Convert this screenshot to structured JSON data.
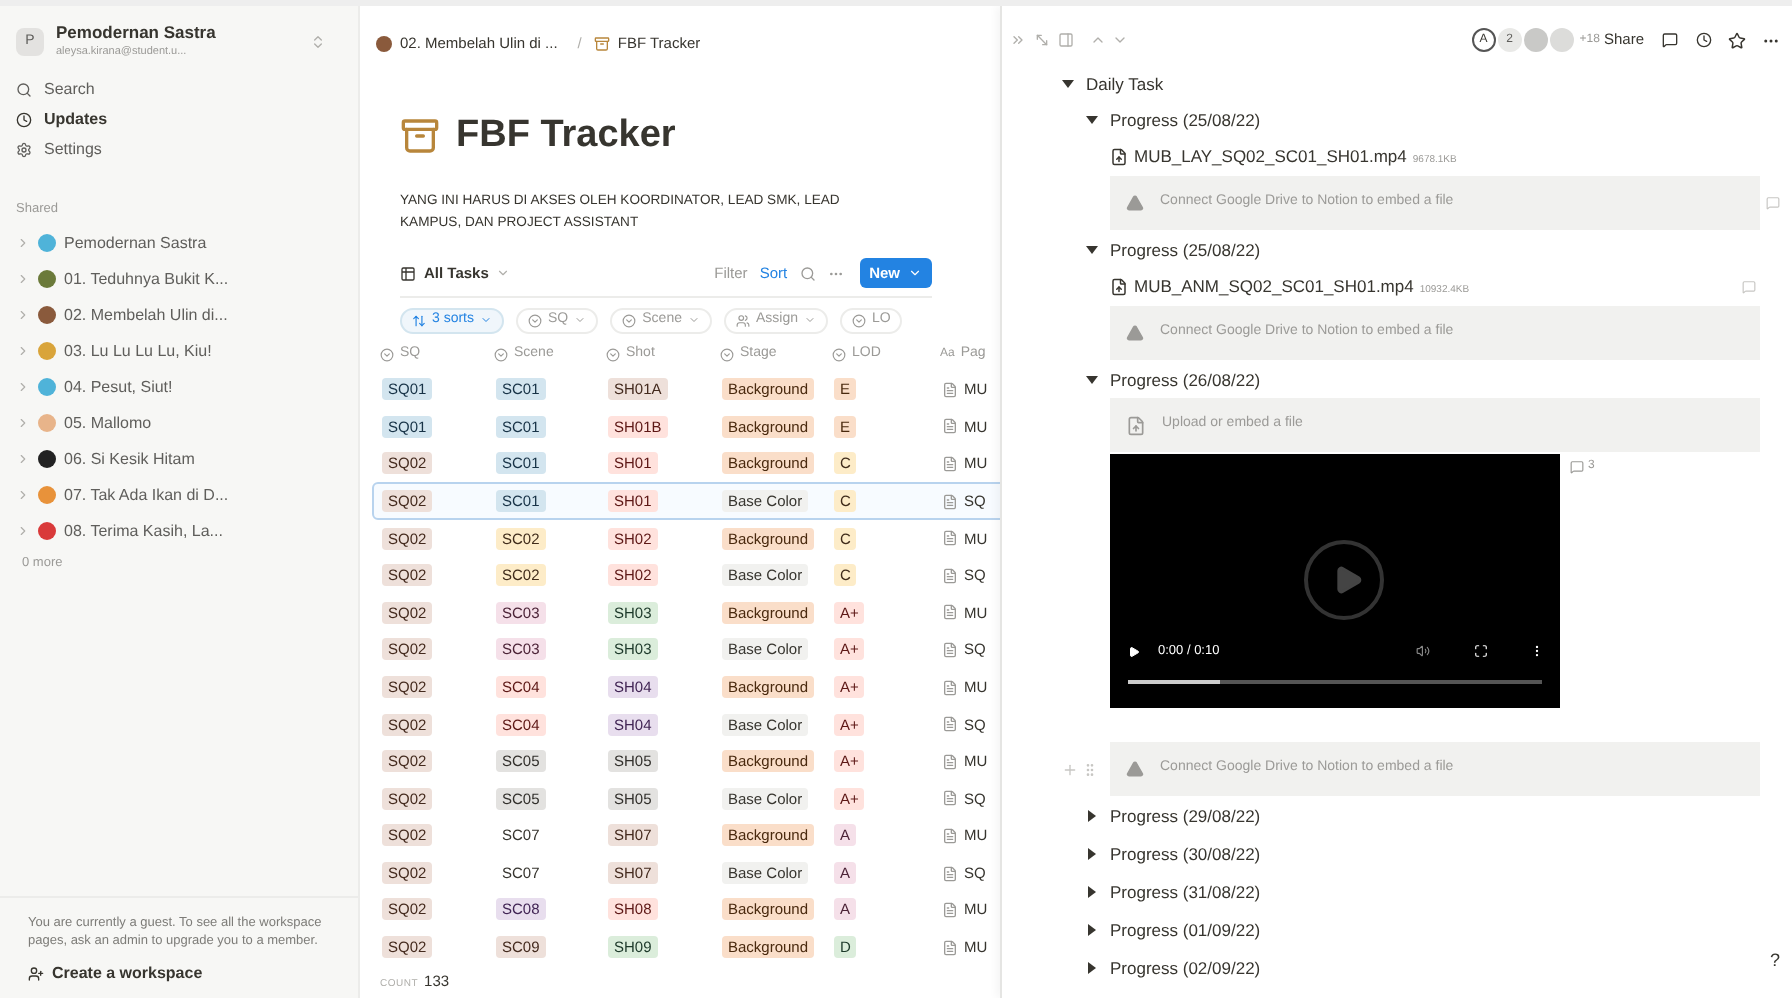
{
  "sidebar": {
    "workspace": {
      "initial": "P",
      "name": "Pemodernan Sastra",
      "email": "aleysa.kirana@student.u..."
    },
    "nav": [
      {
        "kind": "search",
        "label": "Search",
        "selected": false
      },
      {
        "kind": "updates",
        "label": "Updates",
        "selected": true
      },
      {
        "kind": "settings",
        "label": "Settings",
        "selected": false
      }
    ],
    "section": "Shared",
    "pages": [
      {
        "label": "Pemodernan Sastra",
        "color": "#4fb3d9"
      },
      {
        "label": "01. Teduhnya Bukit K...",
        "color": "#6b7a3a"
      },
      {
        "label": "02. Membelah Ulin di...",
        "color": "#8a5a3c"
      },
      {
        "label": "03. Lu Lu Lu Lu, Kiu!",
        "color": "#d9a43a"
      },
      {
        "label": "04. Pesut, Siut!",
        "color": "#4fb3d9"
      },
      {
        "label": "05. Mallomo",
        "color": "#e8b48a"
      },
      {
        "label": "06. Si Kesik Hitam",
        "color": "#222222"
      },
      {
        "label": "07. Tak Ada Ikan di D...",
        "color": "#e8923a"
      },
      {
        "label": "08. Terima Kasih, La...",
        "color": "#d93a3a"
      }
    ],
    "more": "0 more",
    "guest_note": "You are currently a guest. To see all the workspace pages, ask an admin to upgrade you to a member.",
    "create": "Create a workspace"
  },
  "breadcrumbs": [
    "02. Membelah Ulin di ...",
    "FBF Tracker"
  ],
  "breadcrumb_separator": "/",
  "page": {
    "title": "FBF Tracker",
    "description": "YANG INI HARUS DI AKSES OLEH KOORDINATOR, LEAD SMK, LEAD KAMPUS, DAN PROJECT ASSISTANT",
    "view": "All Tasks",
    "filter": "Filter",
    "sort": "Sort",
    "new": "New",
    "chips": [
      {
        "kind": "sort",
        "label": "3 sorts"
      },
      {
        "kind": "select",
        "label": "SQ"
      },
      {
        "kind": "select",
        "label": "Scene"
      },
      {
        "kind": "person",
        "label": "Assign"
      },
      {
        "kind": "select",
        "label": "LO"
      }
    ],
    "columns": [
      {
        "kind": "select",
        "label": "SQ"
      },
      {
        "kind": "select",
        "label": "Scene"
      },
      {
        "kind": "select",
        "label": "Shot"
      },
      {
        "kind": "select",
        "label": "Stage"
      },
      {
        "kind": "select",
        "label": "LOD"
      },
      {
        "kind": "title",
        "icon_text": "Aa",
        "label": "Pag"
      }
    ],
    "rows": [
      {
        "selected": false,
        "tags": [
          {
            "text": "SQ01",
            "color": "#d3e5ef"
          },
          {
            "text": "SC01",
            "color": "#d3e5ef"
          },
          {
            "text": "SH01A",
            "color": "#eee0da"
          },
          {
            "text": "Background",
            "color": "#fadec9"
          },
          {
            "text": "E",
            "color": "#fadec9"
          }
        ],
        "page": "MU"
      },
      {
        "selected": false,
        "tags": [
          {
            "text": "SQ01",
            "color": "#d3e5ef"
          },
          {
            "text": "SC01",
            "color": "#d3e5ef"
          },
          {
            "text": "SH01B",
            "color": "#ffe2dd"
          },
          {
            "text": "Background",
            "color": "#fadec9"
          },
          {
            "text": "E",
            "color": "#fadec9"
          }
        ],
        "page": "MU"
      },
      {
        "selected": false,
        "tags": [
          {
            "text": "SQ02",
            "color": "#eee0da"
          },
          {
            "text": "SC01",
            "color": "#d3e5ef"
          },
          {
            "text": "SH01",
            "color": "#ffe2dd"
          },
          {
            "text": "Background",
            "color": "#fadec9"
          },
          {
            "text": "C",
            "color": "#fdecc8"
          }
        ],
        "page": "MU"
      },
      {
        "selected": true,
        "tags": [
          {
            "text": "SQ02",
            "color": "#eee0da"
          },
          {
            "text": "SC01",
            "color": "#d3e5ef"
          },
          {
            "text": "SH01",
            "color": "#ffe2dd"
          },
          {
            "text": "Base Color",
            "color": "#f1f1ef"
          },
          {
            "text": "C",
            "color": "#fdecc8"
          }
        ],
        "page": "SQ"
      },
      {
        "selected": false,
        "tags": [
          {
            "text": "SQ02",
            "color": "#eee0da"
          },
          {
            "text": "SC02",
            "color": "#fdecc8"
          },
          {
            "text": "SH02",
            "color": "#ffe2dd"
          },
          {
            "text": "Background",
            "color": "#fadec9"
          },
          {
            "text": "C",
            "color": "#fdecc8"
          }
        ],
        "page": "MU"
      },
      {
        "selected": false,
        "tags": [
          {
            "text": "SQ02",
            "color": "#eee0da"
          },
          {
            "text": "SC02",
            "color": "#fdecc8"
          },
          {
            "text": "SH02",
            "color": "#ffe2dd"
          },
          {
            "text": "Base Color",
            "color": "#f1f1ef"
          },
          {
            "text": "C",
            "color": "#fdecc8"
          }
        ],
        "page": "SQ"
      },
      {
        "selected": false,
        "tags": [
          {
            "text": "SQ02",
            "color": "#eee0da"
          },
          {
            "text": "SC03",
            "color": "#f5e0e9"
          },
          {
            "text": "SH03",
            "color": "#dbeddb"
          },
          {
            "text": "Background",
            "color": "#fadec9"
          },
          {
            "text": "A+",
            "color": "#ffe2dd"
          }
        ],
        "page": "MU"
      },
      {
        "selected": false,
        "tags": [
          {
            "text": "SQ02",
            "color": "#eee0da"
          },
          {
            "text": "SC03",
            "color": "#f5e0e9"
          },
          {
            "text": "SH03",
            "color": "#dbeddb"
          },
          {
            "text": "Base Color",
            "color": "#f1f1ef"
          },
          {
            "text": "A+",
            "color": "#ffe2dd"
          }
        ],
        "page": "SQ"
      },
      {
        "selected": false,
        "tags": [
          {
            "text": "SQ02",
            "color": "#eee0da"
          },
          {
            "text": "SC04",
            "color": "#ffe2dd"
          },
          {
            "text": "SH04",
            "color": "#e8deee"
          },
          {
            "text": "Background",
            "color": "#fadec9"
          },
          {
            "text": "A+",
            "color": "#ffe2dd"
          }
        ],
        "page": "MU"
      },
      {
        "selected": false,
        "tags": [
          {
            "text": "SQ02",
            "color": "#eee0da"
          },
          {
            "text": "SC04",
            "color": "#ffe2dd"
          },
          {
            "text": "SH04",
            "color": "#e8deee"
          },
          {
            "text": "Base Color",
            "color": "#f1f1ef"
          },
          {
            "text": "A+",
            "color": "#ffe2dd"
          }
        ],
        "page": "SQ"
      },
      {
        "selected": false,
        "tags": [
          {
            "text": "SQ02",
            "color": "#eee0da"
          },
          {
            "text": "SC05",
            "color": "#e3e2e0"
          },
          {
            "text": "SH05",
            "color": "#e3e2e0"
          },
          {
            "text": "Background",
            "color": "#fadec9"
          },
          {
            "text": "A+",
            "color": "#ffe2dd"
          }
        ],
        "page": "MU"
      },
      {
        "selected": false,
        "tags": [
          {
            "text": "SQ02",
            "color": "#eee0da"
          },
          {
            "text": "SC05",
            "color": "#e3e2e0"
          },
          {
            "text": "SH05",
            "color": "#e3e2e0"
          },
          {
            "text": "Base Color",
            "color": "#f1f1ef"
          },
          {
            "text": "A+",
            "color": "#ffe2dd"
          }
        ],
        "page": "SQ"
      },
      {
        "selected": false,
        "tags": [
          {
            "text": "SQ02",
            "color": "#eee0da"
          },
          {
            "text": "SC07",
            "color": "#ffffff"
          },
          {
            "text": "SH07",
            "color": "#eee0da"
          },
          {
            "text": "Background",
            "color": "#fadec9"
          },
          {
            "text": "A",
            "color": "#f5e0e9"
          }
        ],
        "page": "MU"
      },
      {
        "selected": false,
        "tags": [
          {
            "text": "SQ02",
            "color": "#eee0da"
          },
          {
            "text": "SC07",
            "color": "#ffffff"
          },
          {
            "text": "SH07",
            "color": "#eee0da"
          },
          {
            "text": "Base Color",
            "color": "#f1f1ef"
          },
          {
            "text": "A",
            "color": "#f5e0e9"
          }
        ],
        "page": "SQ"
      },
      {
        "selected": false,
        "tags": [
          {
            "text": "SQ02",
            "color": "#eee0da"
          },
          {
            "text": "SC08",
            "color": "#e8deee"
          },
          {
            "text": "SH08",
            "color": "#ffe2dd"
          },
          {
            "text": "Background",
            "color": "#fadec9"
          },
          {
            "text": "A",
            "color": "#f5e0e9"
          }
        ],
        "page": "MU"
      },
      {
        "selected": false,
        "tags": [
          {
            "text": "SQ02",
            "color": "#eee0da"
          },
          {
            "text": "SC09",
            "color": "#eee0da"
          },
          {
            "text": "SH09",
            "color": "#dbeddb"
          },
          {
            "text": "Background",
            "color": "#fadec9"
          },
          {
            "text": "D",
            "color": "#dbeddb"
          }
        ],
        "page": "MU"
      }
    ],
    "count_label": "COUNT",
    "count": "133"
  },
  "panel": {
    "avatar": "A",
    "avatar_count": "2",
    "more_people": "+18",
    "share": "Share",
    "blocks": [
      {
        "kind": "toggle",
        "label": "Daily Task",
        "expanded": true,
        "children": [
          {
            "kind": "toggle",
            "label": "Progress (25/08/22)",
            "expanded": true,
            "children": [
              {
                "kind": "file",
                "name": "MUB_LAY_SQ02_SC01_SH01.mp4",
                "size": "9678.1KB"
              },
              {
                "kind": "drive",
                "text": "Connect Google Drive to Notion to embed a file",
                "comment": true
              }
            ]
          },
          {
            "kind": "toggle",
            "label": "Progress (25/08/22)",
            "expanded": true,
            "children": [
              {
                "kind": "file",
                "name": "MUB_ANM_SQ02_SC01_SH01.mp4",
                "size": "10932.4KB",
                "comment": true
              },
              {
                "kind": "drive",
                "text": "Connect Google Drive to Notion to embed a file"
              }
            ]
          },
          {
            "kind": "toggle",
            "label": "Progress (26/08/22)",
            "expanded": true,
            "children": [
              {
                "kind": "upload",
                "text": "Upload or embed a file"
              },
              {
                "kind": "video",
                "time": "0:00 / 0:10",
                "level": 0.22,
                "comments": "3"
              },
              {
                "kind": "drive",
                "text": "Connect Google Drive to Notion to embed a file",
                "handles": true
              }
            ]
          },
          {
            "kind": "toggle",
            "label": "Progress (29/08/22)",
            "expanded": false
          },
          {
            "kind": "toggle",
            "label": "Progress (30/08/22)",
            "expanded": false
          },
          {
            "kind": "toggle",
            "label": "Progress (31/08/22)",
            "expanded": false
          },
          {
            "kind": "toggle",
            "label": "Progress (01/09/22)",
            "expanded": false
          },
          {
            "kind": "toggle",
            "label": "Progress (02/09/22)",
            "expanded": false
          }
        ]
      }
    ],
    "help": "?"
  }
}
